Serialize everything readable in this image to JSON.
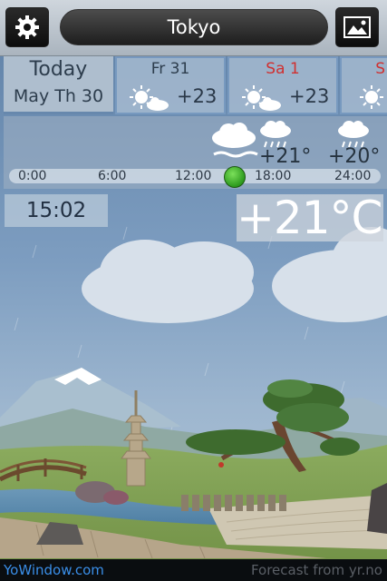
{
  "header": {
    "city": "Tokyo",
    "settings_icon": "gear-icon",
    "gallery_icon": "landscape-picture-icon"
  },
  "days": [
    {
      "name": "Today",
      "date": "May Th 30",
      "selected": true
    },
    {
      "name": "Fr 31",
      "temp": "+23",
      "icon": "sun-cloud-icon",
      "weekend": false
    },
    {
      "name": "Sa 1",
      "temp": "+23",
      "icon": "sun-cloud-icon",
      "weekend": true
    },
    {
      "name": "S",
      "icon": "sun-icon",
      "weekend": true
    }
  ],
  "hourly": {
    "time_labels": [
      "0:00",
      "6:00",
      "12:00",
      "18:00",
      "24:00"
    ],
    "forecasts": [
      {
        "temp": "+21°",
        "icon": "rain-cloud-icon"
      },
      {
        "temp": "+20°",
        "icon": "rain-cloud-icon"
      }
    ],
    "current_icon": "cloud-fog-icon",
    "knob_position": "15:02"
  },
  "current": {
    "time": "15:02",
    "temperature": "+21°C"
  },
  "footer": {
    "brand": "YoWindow.com",
    "source": "Forecast from yr.no"
  },
  "colors": {
    "brand_link": "#3a8ee8",
    "weekend_red": "#d03030",
    "knob_green": "#2d9a1e"
  }
}
